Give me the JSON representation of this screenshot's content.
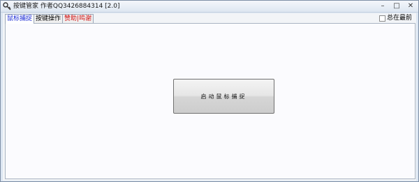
{
  "window": {
    "title": "按键管家 作者QQ3426884314 [2.0]",
    "icon": "key-icon",
    "buttons": {
      "minimize": "–",
      "maximize": "□",
      "close": "✕"
    }
  },
  "tabs": [
    {
      "label": "鼠标捕捉",
      "active": true
    },
    {
      "label": "按键操作",
      "active": false
    },
    {
      "label_a": "赞助",
      "label_sep": "|",
      "label_b": "鸣谢",
      "active": false,
      "color": "#d01010"
    }
  ],
  "topmost": {
    "label": "总在最前",
    "checked": false
  },
  "main": {
    "capture_button": "启动鼠标捕捉"
  }
}
